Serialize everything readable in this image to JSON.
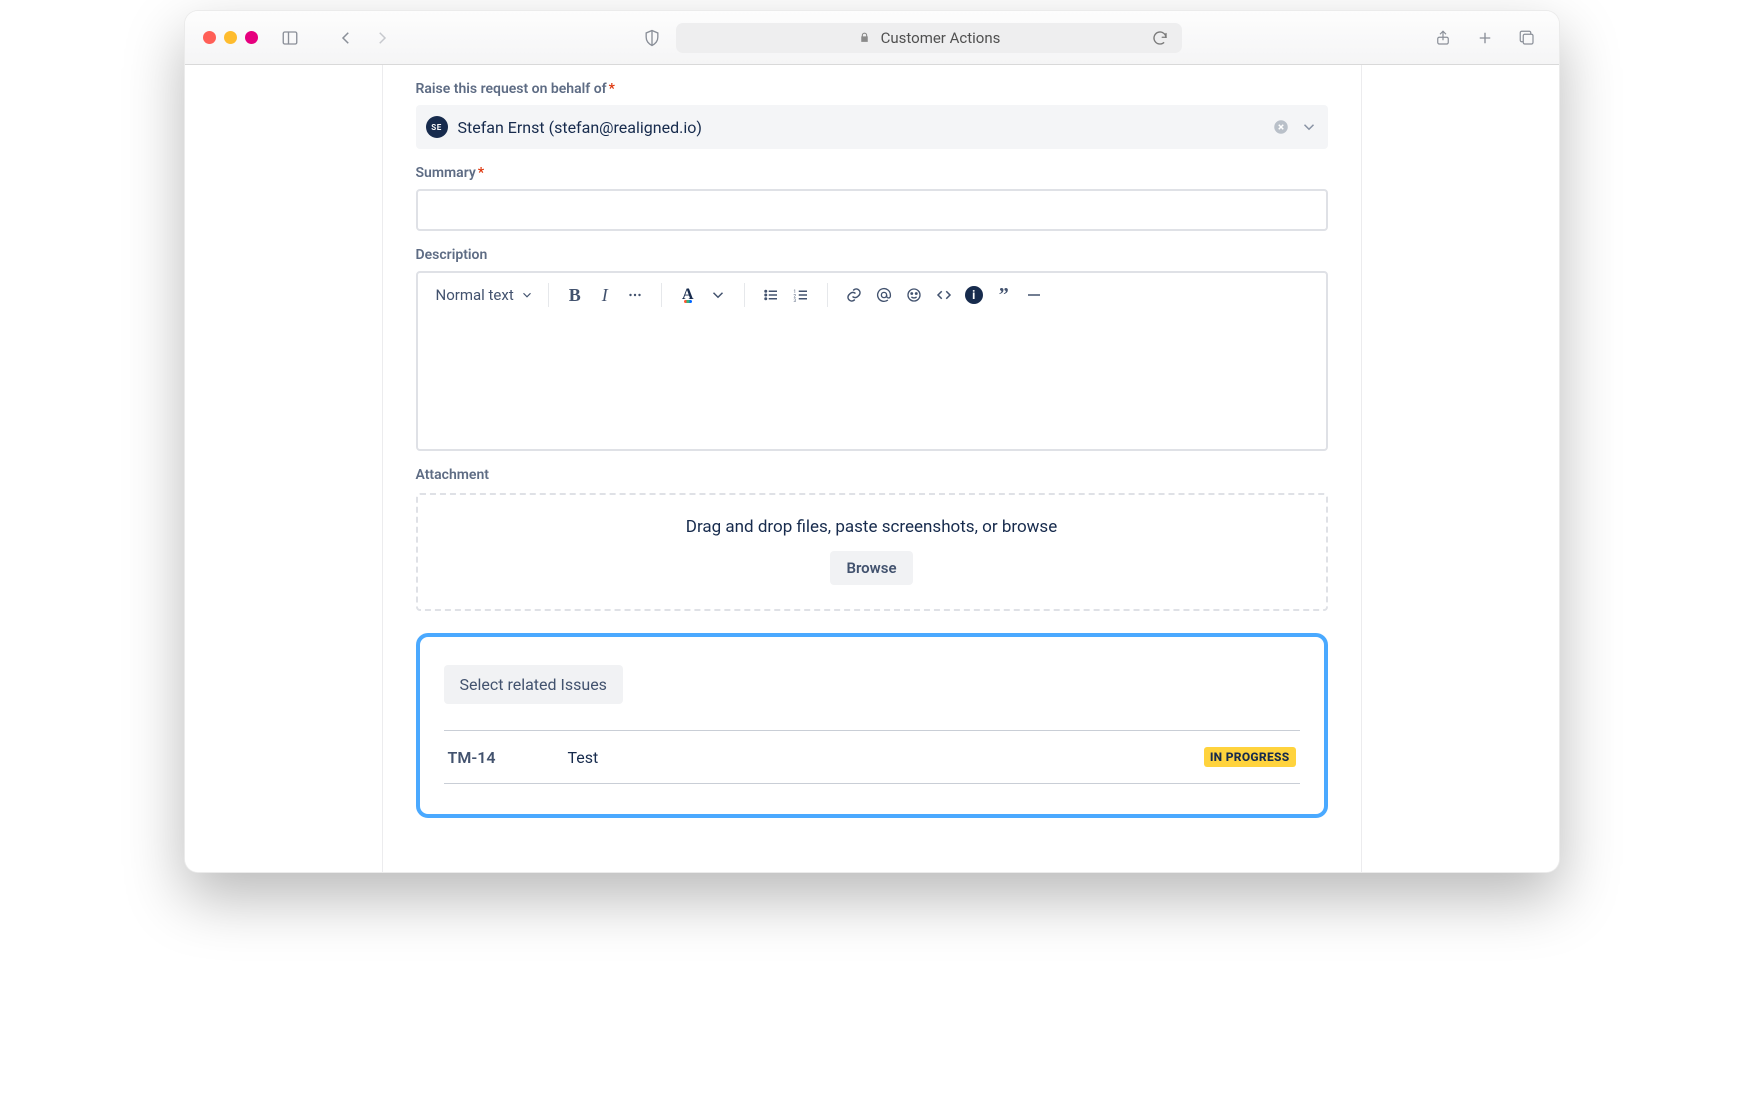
{
  "browser": {
    "title": "Customer Actions"
  },
  "form": {
    "requesterLabel": "Raise this request on behalf of",
    "requesterInitials": "SE",
    "requesterText": "Stefan Ernst (stefan@realigned.io)",
    "summaryLabel": "Summary",
    "descriptionLabel": "Description",
    "textStyleLabel": "Normal text",
    "attachmentLabel": "Attachment",
    "attachmentHint": "Drag and drop files, paste screenshots, or browse",
    "browseLabel": "Browse"
  },
  "related": {
    "button": "Select related Issues",
    "rows": [
      {
        "key": "TM-14",
        "summary": "Test",
        "status": "IN PROGRESS"
      }
    ]
  }
}
